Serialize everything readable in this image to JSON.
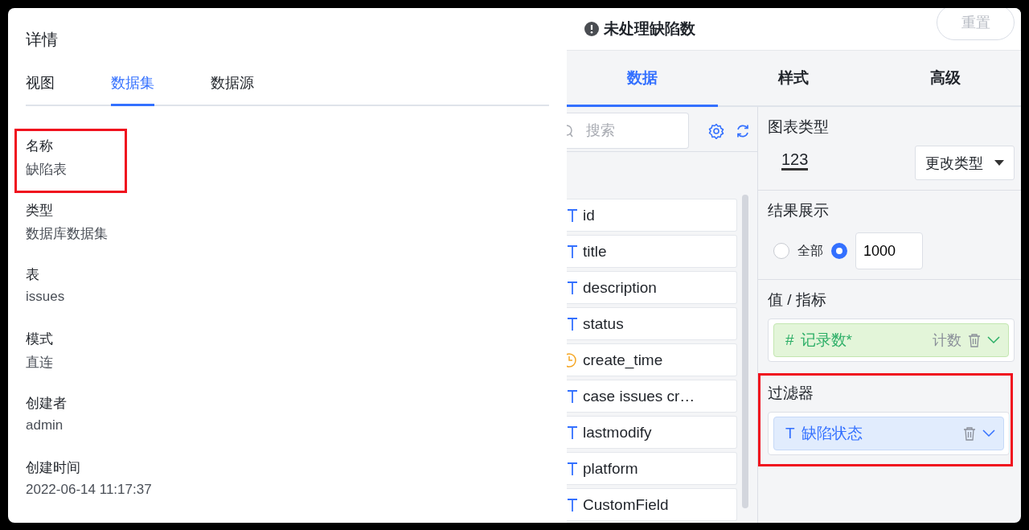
{
  "detail": {
    "title": "详情",
    "tabs": [
      {
        "label": "视图",
        "selected": false
      },
      {
        "label": "数据集",
        "selected": true
      },
      {
        "label": "数据源",
        "selected": false
      }
    ],
    "items": [
      {
        "label": "名称",
        "value": "缺陷表",
        "highlighted": true
      },
      {
        "label": "类型",
        "value": "数据库数据集",
        "highlighted": false
      },
      {
        "label": "表",
        "value": "issues",
        "highlighted": false
      },
      {
        "label": "模式",
        "value": "直连",
        "highlighted": false
      },
      {
        "label": "创建者",
        "value": "admin",
        "highlighted": false
      },
      {
        "label": "创建时间",
        "value": "2022-06-14 11:17:37",
        "highlighted": false
      }
    ]
  },
  "editor": {
    "chart_title": "未处理缺陷数",
    "reset_button": "重置",
    "tabs": [
      {
        "label": "数据",
        "selected": true
      },
      {
        "label": "样式",
        "selected": false
      },
      {
        "label": "高级",
        "selected": false
      }
    ],
    "search": {
      "placeholder": "搜索"
    },
    "fields": [
      {
        "kind": "text",
        "name": "id"
      },
      {
        "kind": "text",
        "name": "title"
      },
      {
        "kind": "text",
        "name": "description"
      },
      {
        "kind": "text",
        "name": "status"
      },
      {
        "kind": "time",
        "name": "create_time"
      },
      {
        "kind": "text",
        "name": "case issues cr…"
      },
      {
        "kind": "text",
        "name": "lastmodify"
      },
      {
        "kind": "text",
        "name": "platform"
      },
      {
        "kind": "text",
        "name": "CustomField"
      }
    ],
    "chart_type": {
      "label": "图表类型",
      "icon_text": "123",
      "change_button": "更改类型"
    },
    "result_display": {
      "label": "结果展示",
      "options": [
        {
          "label": "全部",
          "selected": false
        },
        {
          "value": "1000",
          "selected": true
        }
      ]
    },
    "sections": [
      {
        "label": "值 / 指标",
        "highlighted": false,
        "items": [
          {
            "kind": "measure",
            "symbol": "#",
            "name": "记录数*",
            "aggregate": "计数"
          }
        ]
      },
      {
        "label": "过滤器",
        "highlighted": true,
        "items": [
          {
            "kind": "dimension",
            "symbol": "T",
            "name": "缺陷状态"
          }
        ]
      }
    ]
  }
}
